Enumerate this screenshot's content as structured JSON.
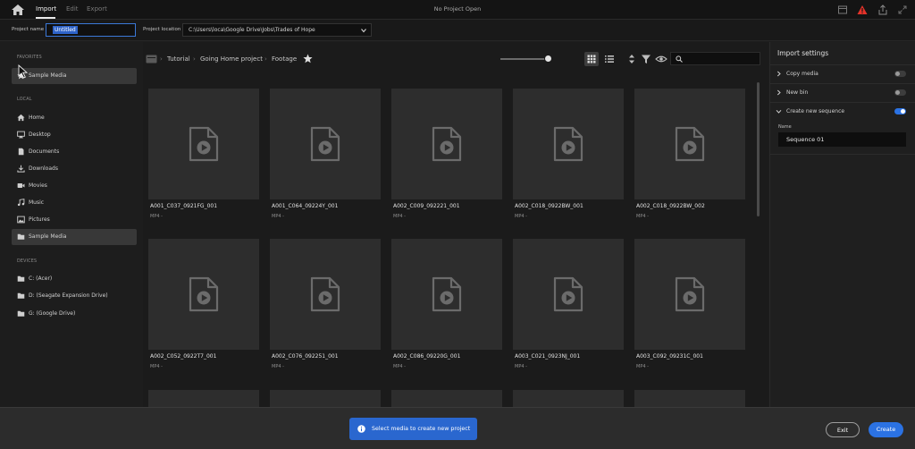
{
  "app": {
    "title": "No Project Open",
    "tabs": [
      {
        "label": "Import",
        "active": true
      },
      {
        "label": "Edit",
        "active": false
      },
      {
        "label": "Export",
        "active": false
      }
    ]
  },
  "project": {
    "name_label": "Project name",
    "name_value": "Untitled",
    "location_label": "Project location",
    "location_value": "C:\\Users\\loca\\Google Drive\\Jobs\\Trades of Hope"
  },
  "sidebar": {
    "favorites_header": "FAVORITES",
    "favorites": [
      {
        "label": "Sample Media",
        "icon": "star-icon"
      }
    ],
    "local_header": "LOCAL",
    "local": [
      {
        "label": "Home",
        "icon": "home-icon"
      },
      {
        "label": "Desktop",
        "icon": "desktop-icon"
      },
      {
        "label": "Documents",
        "icon": "document-icon"
      },
      {
        "label": "Downloads",
        "icon": "download-icon"
      },
      {
        "label": "Movies",
        "icon": "movie-icon"
      },
      {
        "label": "Music",
        "icon": "music-icon"
      },
      {
        "label": "Pictures",
        "icon": "picture-icon"
      },
      {
        "label": "Sample Media",
        "icon": "folder-icon"
      }
    ],
    "devices_header": "DEVICES",
    "devices": [
      {
        "label": "C: (Acer)",
        "icon": "folder-icon"
      },
      {
        "label": "D: (Seagate Expansion Drive)",
        "icon": "folder-icon"
      },
      {
        "label": "G: (Google Drive)",
        "icon": "folder-icon"
      }
    ]
  },
  "breadcrumb": [
    "Tutorial",
    "Going Home project",
    "Footage"
  ],
  "media": [
    {
      "name": "A001_C037_0921FG_001",
      "meta": "MP4 -"
    },
    {
      "name": "A001_C064_09224Y_001",
      "meta": "MP4 -"
    },
    {
      "name": "A002_C009_092221_001",
      "meta": "MP4 -"
    },
    {
      "name": "A002_C018_0922BW_001",
      "meta": "MP4 -"
    },
    {
      "name": "A002_C018_0922BW_002",
      "meta": "MP4 -"
    },
    {
      "name": "A002_C052_0922T7_001",
      "meta": "MP4 -"
    },
    {
      "name": "A002_C076_092251_001",
      "meta": "MP4 -"
    },
    {
      "name": "A002_C086_09220G_001",
      "meta": "MP4 -"
    },
    {
      "name": "A003_C021_0923NJ_001",
      "meta": "MP4 -"
    },
    {
      "name": "A003_C092_09231C_001",
      "meta": "MP4 -"
    }
  ],
  "import_settings": {
    "title": "Import settings",
    "options": [
      {
        "label": "Copy media",
        "enabled": false,
        "expanded": false
      },
      {
        "label": "New bin",
        "enabled": false,
        "expanded": false
      },
      {
        "label": "Create new sequence",
        "enabled": true,
        "expanded": true
      }
    ],
    "sequence_name_label": "Name",
    "sequence_name_value": "Sequence 01"
  },
  "footer": {
    "toast": "Select media to create new project",
    "exit_label": "Exit",
    "create_label": "Create"
  },
  "colors": {
    "accent": "#2b72e3",
    "toast": "#2a67cf"
  }
}
